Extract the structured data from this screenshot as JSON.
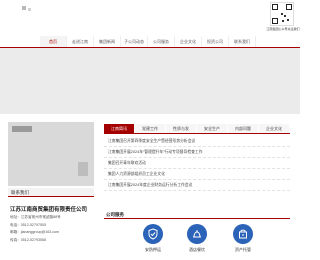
{
  "qr": {
    "caption": "江南集团公众号关注我们"
  },
  "nav": {
    "items": [
      "首页",
      "走进江南",
      "集团新闻",
      "子公司动态",
      "公司服务",
      "企业文化",
      "投资公司",
      "联系我们"
    ]
  },
  "tabs": [
    "江南简讯",
    "党建工作",
    "性质与发",
    "安全生产",
    "内部问题",
    "企业文化"
  ],
  "news": [
    "江南集团召开第四季度安全生产暨经营形势分析会议",
    "江南集团开展2024年“管理提升年”行动专项督导检查工作",
    "集团召开青年联欢活动",
    "集团人力资源部组织员工企业文化",
    "江南集团开展2024年度企业财务运行分析工作会议"
  ],
  "left": {
    "section_title": "联系我们",
    "company": "江苏江南商贸集团有限责任公司",
    "contact": [
      "地址：江苏省常州市常武路88号",
      "电话：0512-52797505",
      "邮箱：jiananggroup@163.com",
      "传真：0512-52793568"
    ]
  },
  "services": {
    "title": "公司服务",
    "items": [
      {
        "label": "安防押运",
        "icon": "security-shield-icon"
      },
      {
        "label": "酒店餐饮",
        "icon": "hotel-dining-icon"
      },
      {
        "label": "资产托管",
        "icon": "asset-custody-icon"
      }
    ]
  },
  "colors": {
    "accent": "#a40000",
    "service_blue": "#2b63b8",
    "banner_gray": "#ebebeb"
  }
}
